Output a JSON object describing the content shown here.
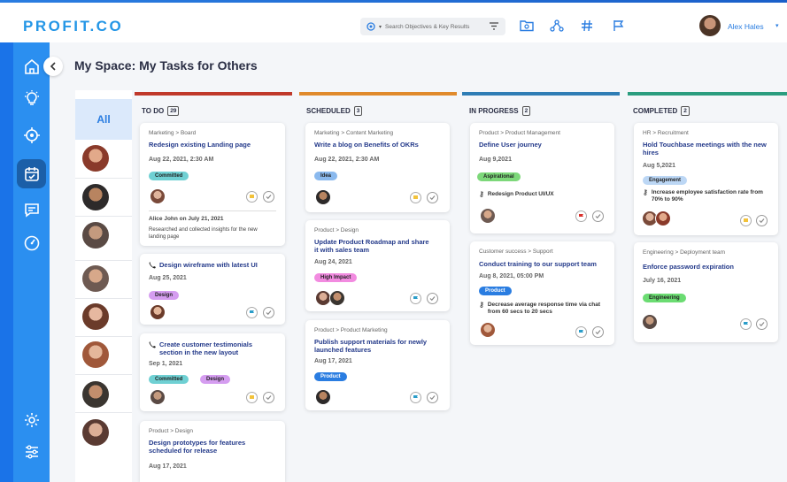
{
  "app": {
    "logo": "PROFIT.CO"
  },
  "search": {
    "placeholder": "Search Objectives & Key Results"
  },
  "user": {
    "name": "Alex Hales"
  },
  "page": {
    "title": "My Space: My Tasks for Others"
  },
  "assignees": {
    "all_label": "All"
  },
  "columns": [
    {
      "title": "TO DO",
      "count": "29",
      "color": "#c0392b"
    },
    {
      "title": "SCHEDULED",
      "count": "3",
      "color": "#e08a2c"
    },
    {
      "title": "IN PROGRESS",
      "count": "2",
      "color": "#2e7db5"
    },
    {
      "title": "COMPLETED",
      "count": "2",
      "color": "#2a9d7f"
    }
  ],
  "cards": {
    "todo1": {
      "crumb": "Marketing > Board",
      "title": "Redesign existing Landing page",
      "date": "Aug 22, 2021, 2:30 AM",
      "tag": "Committed",
      "note_head": "Alice John on July 21, 2021",
      "note_body": "Researched and collected insights for the new landing page"
    },
    "todo2": {
      "title": "Design wireframe with latest UI",
      "date": "Aug 25, 2021",
      "tag": "Design"
    },
    "todo3": {
      "title": "Create customer testimonials section in the new layout",
      "date": "Sep 1, 2021",
      "tag1": "Committed",
      "tag2": "Design"
    },
    "todo4": {
      "crumb": "Product > Design",
      "title": "Design prototypes for features scheduled for release",
      "date": "Aug 17, 2021"
    },
    "sch1": {
      "crumb": "Marketing > Content Marketing",
      "title": "Write a blog on Benefits of OKRs",
      "date": "Aug 22, 2021, 2:30 AM",
      "tag": "Idea"
    },
    "sch2": {
      "crumb": "Product > Design",
      "title": "Update Product Roadmap and share it with sales team",
      "date": "Aug 24, 2021",
      "tag": "High Impact"
    },
    "sch3": {
      "crumb": "Product > Product Marketing",
      "title": "Publish support materials for newly launched features",
      "date": "Aug 17, 2021",
      "tag": "Product"
    },
    "prog1": {
      "crumb": "Product > Product Management",
      "title": "Define User journey",
      "date": "Aug 9,2021",
      "tag": "Aspirational",
      "kr": "Redesign Product UI/UX"
    },
    "prog2": {
      "crumb": "Customer success > Support",
      "title": "Conduct training to our support team",
      "date": "Aug 8, 2021, 05:00 PM",
      "tag": "Product",
      "kr": "Decrease average response time via chat from 60 secs to 20 secs"
    },
    "comp1": {
      "crumb": "HR > Recruitment",
      "title": "Hold Touchbase meetings with the new hires",
      "date": "Aug 5,2021",
      "tag": "Engagement",
      "kr": "Increase employee satisfaction rate from 70% to 90%"
    },
    "comp2": {
      "crumb": "Engineering > Deployment team",
      "title": "Enforce password expiration",
      "date": "July 16, 2021",
      "tag": "Engineering"
    }
  }
}
